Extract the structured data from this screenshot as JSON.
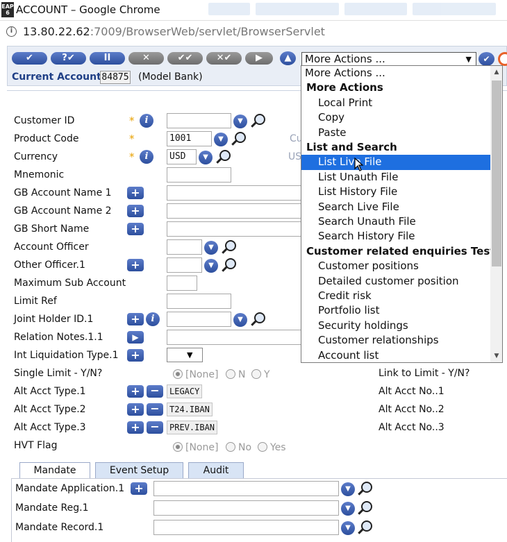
{
  "window": {
    "title": "ACCOUNT – Google Chrome",
    "app_icon_text": "EAP 6"
  },
  "address_bar": {
    "host": "13.80.22.62",
    "path": ":7009/BrowserWeb/servlet/BrowserServlet"
  },
  "toolbar": {
    "buttons": [
      "✔",
      "?✔",
      "II",
      "✕",
      "✔✔",
      "✕✔",
      "▶"
    ],
    "more_actions_label": "More Actions ..."
  },
  "account": {
    "label": "Current Account",
    "number": "84875",
    "bank": "(Model Bank)"
  },
  "form": {
    "labels": {
      "customer_id": "Customer ID",
      "product_code": "Product Code",
      "currency": "Currency",
      "mnemonic": "Mnemonic",
      "gb_account_name_1": "GB Account Name 1",
      "gb_account_name_2": "GB Account Name 2",
      "gb_short_name": "GB Short Name",
      "account_officer": "Account Officer",
      "other_officer": "Other Officer.1",
      "max_sub_account": "Maximum Sub Account",
      "limit_ref": "Limit Ref",
      "joint_holder": "Joint Holder ID.1",
      "relation_notes": "Relation Notes.1.1",
      "int_liquidation": "Int Liquidation Type.1",
      "single_limit": "Single Limit - Y/N?",
      "alt_acct_type_1": "Alt Acct Type.1",
      "alt_acct_type_2": "Alt Acct Type.2",
      "alt_acct_type_3": "Alt Acct Type.3",
      "hvt_flag": "HVT Flag"
    },
    "values": {
      "product_code": "1001",
      "currency": "USD",
      "alt_acct_type_1": "LEGACY",
      "alt_acct_type_2": "T24.IBAN",
      "alt_acct_type_3": "PREV.IBAN"
    },
    "ghost_labels": {
      "product_code_right": "Cu",
      "currency_right": "US"
    },
    "radio": {
      "none": "[None]",
      "n": "N",
      "y": "Y",
      "no": "No",
      "yes": "Yes"
    },
    "right_labels": {
      "link_to_limit": "Link to Limit - Y/N?",
      "alt_acct_no_1": "Alt Acct No..1",
      "alt_acct_no_2": "Alt Acct No..2",
      "alt_acct_no_3": "Alt Acct No..3"
    }
  },
  "tabs": [
    "Mandate",
    "Event Setup",
    "Audit"
  ],
  "mandate": {
    "application": "Mandate Application.1",
    "reg": "Mandate Reg.1",
    "record": "Mandate Record.1"
  },
  "dropdown": {
    "items": [
      {
        "kind": "plain",
        "label": "More Actions ..."
      },
      {
        "kind": "group",
        "label": "More Actions"
      },
      {
        "kind": "option",
        "label": "Local Print"
      },
      {
        "kind": "option",
        "label": "Copy"
      },
      {
        "kind": "option",
        "label": "Paste"
      },
      {
        "kind": "group",
        "label": "List and Search"
      },
      {
        "kind": "option",
        "label": "List Live File",
        "highlighted": true
      },
      {
        "kind": "option",
        "label": "List Unauth File"
      },
      {
        "kind": "option",
        "label": "List History File"
      },
      {
        "kind": "option",
        "label": "Search Live File"
      },
      {
        "kind": "option",
        "label": "Search Unauth File"
      },
      {
        "kind": "option",
        "label": "Search History File"
      },
      {
        "kind": "group",
        "label": "Customer related enquiries Test"
      },
      {
        "kind": "option",
        "label": "Customer positions"
      },
      {
        "kind": "option",
        "label": "Detailed customer position"
      },
      {
        "kind": "option",
        "label": "Credit risk"
      },
      {
        "kind": "option",
        "label": "Portfolio list"
      },
      {
        "kind": "option",
        "label": "Security holdings"
      },
      {
        "kind": "option",
        "label": "Customer relationships"
      },
      {
        "kind": "option",
        "label": "Account list"
      }
    ]
  },
  "colors": {
    "accent_blue": "#2d4f9e",
    "highlight": "#1e6fe0",
    "required_star": "#e8a000",
    "label_blue": "#1f3f86"
  }
}
